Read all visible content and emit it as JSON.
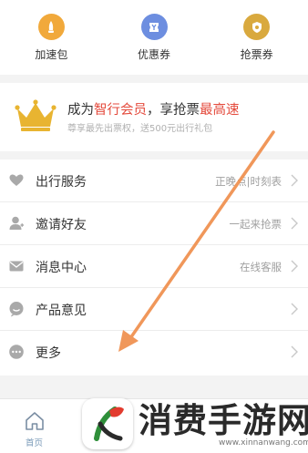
{
  "top_grid": {
    "items": [
      {
        "label": "加速包",
        "icon": "rocket-icon",
        "color": "#f1a93b"
      },
      {
        "label": "优惠券",
        "icon": "coupon-icon",
        "color": "#6d8ee0"
      },
      {
        "label": "抢票券",
        "icon": "ticket-icon",
        "color": "#d9a93e"
      }
    ]
  },
  "vip": {
    "title_prefix": "成为",
    "title_highlight1": "智行会员",
    "title_middle": "，享抢票",
    "title_highlight2": "最高速",
    "subtitle": "尊享最先出票权，送500元出行礼包",
    "highlight_color": "#e44a3c"
  },
  "menu": {
    "items": [
      {
        "label": "出行服务",
        "sub": "正晚点|时刻表",
        "icon": "heart-icon"
      },
      {
        "label": "邀请好友",
        "sub": "一起来抢票",
        "icon": "user-icon"
      },
      {
        "label": "消息中心",
        "sub": "在线客服",
        "icon": "mail-icon"
      },
      {
        "label": "产品意见",
        "sub": "",
        "icon": "feedback-icon"
      },
      {
        "label": "更多",
        "sub": "",
        "icon": "more-icon"
      }
    ]
  },
  "bottom_nav": {
    "home_label": "首页"
  },
  "watermark": {
    "text": "消费手游网",
    "url": "www.xinnanwang.com"
  },
  "colors": {
    "arrow": "#f0975a",
    "icon_gray": "#a9a9a9"
  }
}
